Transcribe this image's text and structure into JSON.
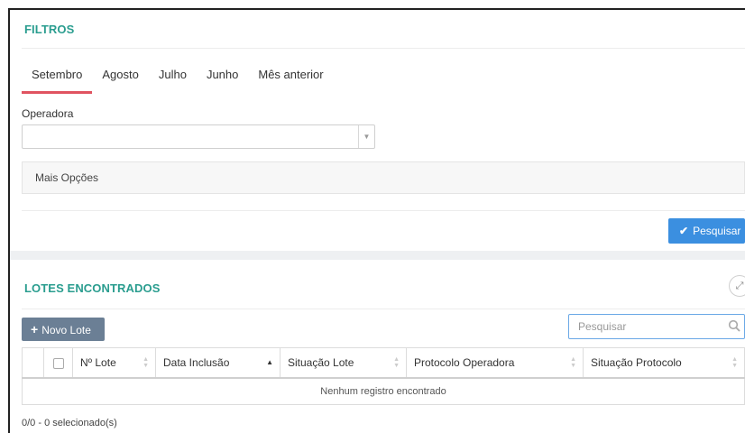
{
  "filtros": {
    "title": "FILTROS",
    "tabs": [
      {
        "label": "Setembro",
        "active": true
      },
      {
        "label": "Agosto"
      },
      {
        "label": "Julho"
      },
      {
        "label": "Junho"
      },
      {
        "label": "Mês anterior"
      }
    ],
    "operadora_label": "Operadora",
    "operadora_value": "",
    "mais_opcoes": "Mais Opções",
    "pesquisar_button": "Pesquisar"
  },
  "lotes": {
    "title": "LOTES ENCONTRADOS",
    "novo_lote_button": "Novo Lote",
    "search_placeholder": "Pesquisar",
    "columns": [
      "Nº Lote",
      "Data Inclusão",
      "Situação Lote",
      "Protocolo Operadora",
      "Situação Protocolo"
    ],
    "sorted_column": "Data Inclusão",
    "empty_message": "Nenhum registro encontrado",
    "footer_status": "0/0 - 0 selecionado(s)"
  },
  "colors": {
    "accent_title": "#2a9d8f",
    "tab_underline": "#e05360",
    "primary_button": "#3b8fe0",
    "secondary_button": "#6b7f95"
  }
}
